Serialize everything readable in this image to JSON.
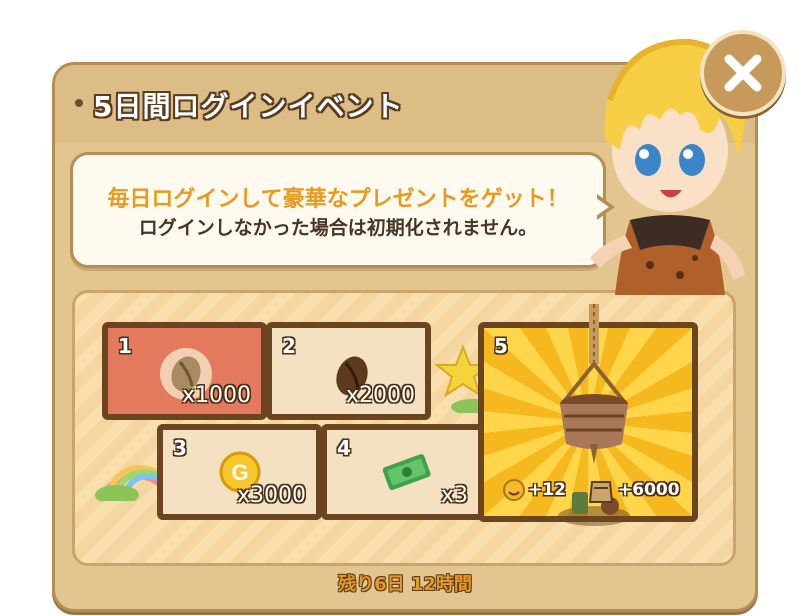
{
  "dialog": {
    "title": "5日間ログインイベント",
    "message_highlight": "毎日ログインして豪華なプレゼントをゲット！",
    "message_note": "ログインしなかった場合は初期化されません。",
    "remaining": "残り6日 12時間"
  },
  "rewards": [
    {
      "day": "1",
      "item": "coffee-bean-light",
      "qty": "x1000",
      "claimed": true
    },
    {
      "day": "2",
      "item": "coffee-bean-dark",
      "qty": "x2000",
      "claimed": false
    },
    {
      "day": "3",
      "item": "gold-coin",
      "qty": "x3000",
      "claimed": false
    },
    {
      "day": "4",
      "item": "cash-bundle",
      "qty": "x3",
      "claimed": false
    },
    {
      "day": "5",
      "item": "hanging-planter-decor",
      "bonus1": "+12",
      "bonus2": "+6000",
      "claimed": false
    }
  ],
  "colors": {
    "panel": "#e3c590",
    "border": "#6b4520",
    "highlight_text": "#e89a1e",
    "claimed_tile": "#e37a5e",
    "grand_prize_bg": "#ffd64a"
  }
}
